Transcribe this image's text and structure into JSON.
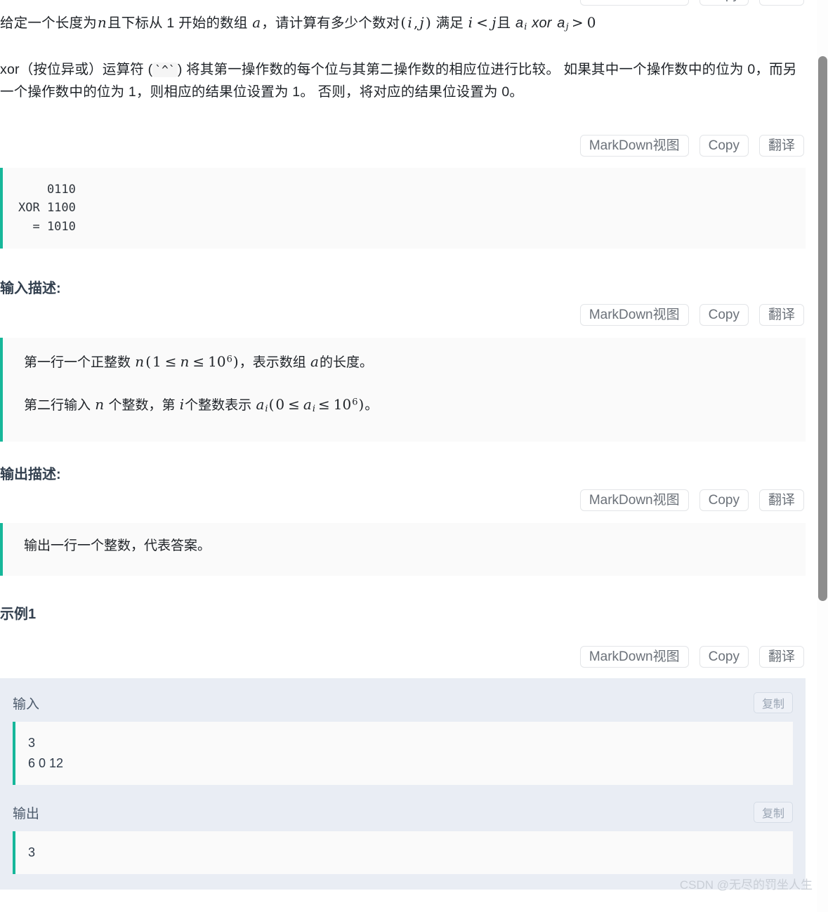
{
  "colors": {
    "accent_teal": "#16b79a",
    "heading": "#33404f",
    "block_bg": "#fafafa",
    "example_bg": "#e9edf4",
    "button_border": "#e3e5e8",
    "button_text": "#6b7179",
    "watermark": "#c9ced6",
    "scrollbar_thumb": "#8d8d8d"
  },
  "toolbar": {
    "markdown_label": "MarkDown视图",
    "copy_label": "Copy",
    "translate_label": "翻译"
  },
  "problem": {
    "statement_prefix": "给定一个长度为",
    "statement_n": "n",
    "statement_mid1": "且下标从 1 开始的数组",
    "statement_a": "a",
    "statement_mid2": "，请计算有多少个数对",
    "statement_pair_open": "(",
    "statement_pair_i": "i",
    "statement_pair_comma": ",",
    "statement_pair_j": "j",
    "statement_pair_close": ")",
    "statement_mid3": "满足",
    "statement_i2": "i",
    "statement_lt": "<",
    "statement_j2": "j",
    "statement_mid4": "且",
    "statement_ai": "a",
    "statement_ai_sub": "i",
    "statement_xor": "xor",
    "statement_aj": "a",
    "statement_aj_sub": "j",
    "statement_gt": ">",
    "statement_zero": "0",
    "xor_desc_part1": "xor（按位异或）运算符 (",
    "xor_desc_code": "`^`",
    "xor_desc_part2": ") 将其第一操作数的每个位与其第二操作数的相应位进行比较。 如果其中一个操作数中的位为 0，而另一个操作数中的位为 1，则相应的结果位设置为 1。 否则，将对应的结果位设置为 0。"
  },
  "xor_example_block": {
    "code": "    0110\nXOR 1100\n  = 1010"
  },
  "input_section": {
    "heading": "输入描述:",
    "line1_prefix": "第一行一个正整数",
    "line1_n": "n",
    "line1_paren_open": "(",
    "line1_one": "1",
    "line1_le1": "≤",
    "line1_n2": "n",
    "line1_le2": "≤",
    "line1_ten": "10",
    "line1_exp": "6",
    "line1_paren_close": ")",
    "line1_suffix_a": "，表示数组",
    "line1_a": "a",
    "line1_suffix_b": "的长度。",
    "line2_prefix": "第二行输入",
    "line2_n": "n",
    "line2_mid1": "个整数，第",
    "line2_i": "i",
    "line2_mid2": "个整数表示",
    "line2_a": "a",
    "line2_a_sub": "i",
    "line2_paren_open": "(",
    "line2_zero": "0",
    "line2_le1": "≤",
    "line2_a2": "a",
    "line2_a2_sub": "i",
    "line2_le2": "≤",
    "line2_ten": "10",
    "line2_exp": "6",
    "line2_paren_close": ")",
    "line2_suffix": "。"
  },
  "output_section": {
    "heading": "输出描述:",
    "text": "输出一行一个整数，代表答案。"
  },
  "example_section": {
    "heading": "示例1",
    "input_label": "输入",
    "input_copy_label": "复制",
    "input_value": "3\n6 0 12",
    "output_label": "输出",
    "output_copy_label": "复制",
    "output_value": "3"
  },
  "watermark": {
    "text": "CSDN @无尽的罚坐人生"
  }
}
